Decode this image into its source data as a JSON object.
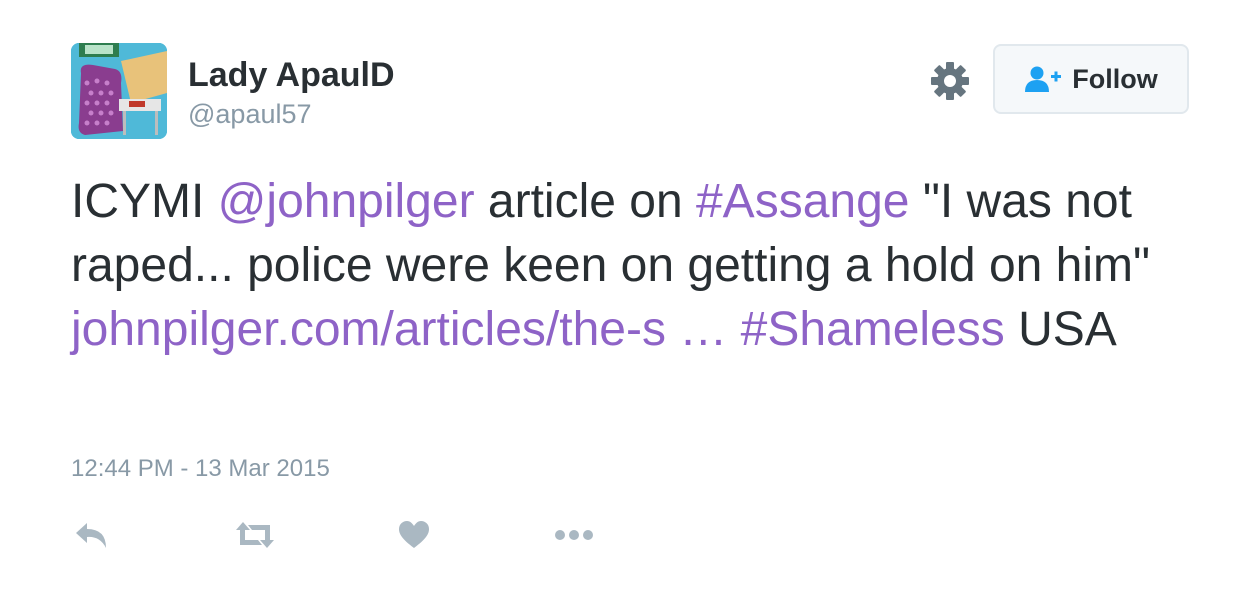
{
  "author": {
    "display_name": "Lady ApaulD",
    "handle": "@apaul57"
  },
  "header": {
    "settings_icon": "gear-icon",
    "follow_button": {
      "label": "Follow",
      "icon": "add-user-icon"
    }
  },
  "tweet": {
    "segments": [
      {
        "text": "ICYMI ",
        "type": "text"
      },
      {
        "text": "@johnpilger",
        "type": "mention"
      },
      {
        "text": " article on ",
        "type": "text"
      },
      {
        "text": "#Assange",
        "type": "hashtag"
      },
      {
        "text": " \"I was not raped... police were keen on getting a hold on him\" ",
        "type": "text"
      },
      {
        "text": "johnpilger.com/articles/the-s  …",
        "type": "url"
      },
      {
        "text": " ",
        "type": "text"
      },
      {
        "text": "#Shameless",
        "type": "hashtag"
      },
      {
        "text": " USA",
        "type": "text"
      }
    ],
    "timestamp": "12:44 PM - 13 Mar 2015"
  },
  "actions": [
    {
      "name": "reply",
      "icon": "reply-icon"
    },
    {
      "name": "retweet",
      "icon": "retweet-icon"
    },
    {
      "name": "like",
      "icon": "heart-icon"
    },
    {
      "name": "more",
      "icon": "more-icon"
    }
  ],
  "colors": {
    "link": "#8e63c7",
    "text": "#292f33",
    "muted": "#8899a6",
    "follow_icon": "#1da1f2"
  }
}
